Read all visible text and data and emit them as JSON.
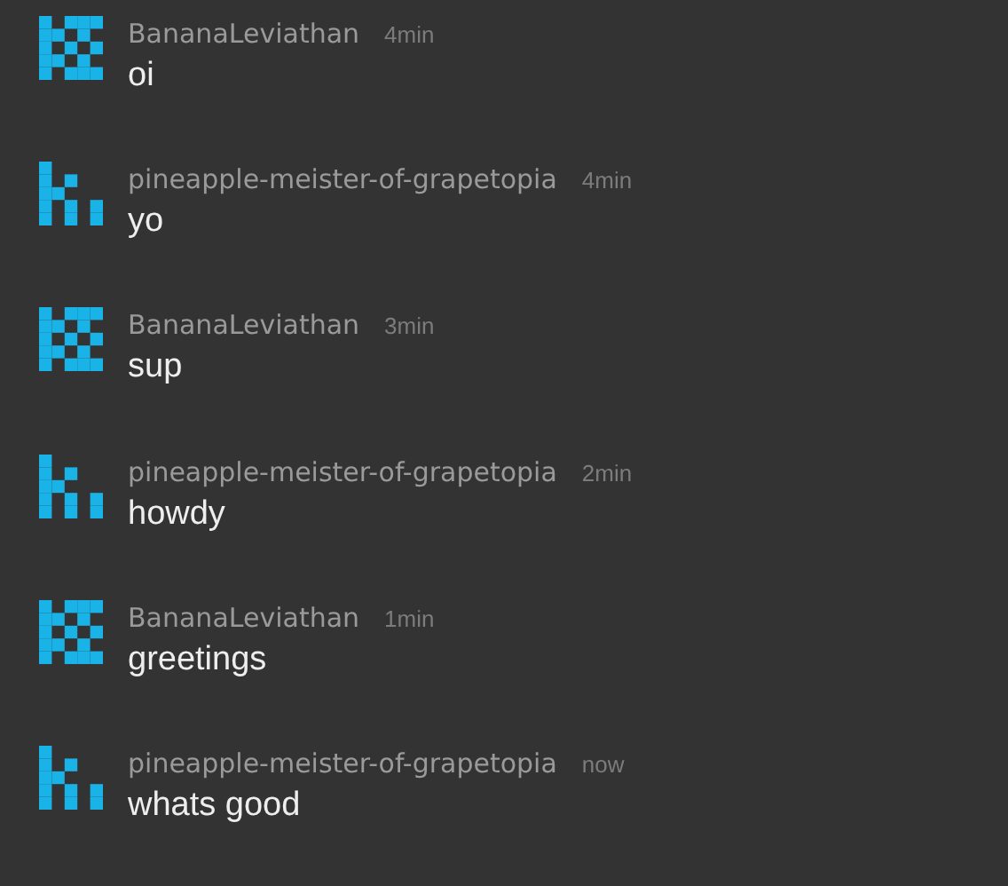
{
  "messages": [
    {
      "author": "BananaLeviathan",
      "kind": "grid",
      "time": "4min",
      "text": "oi"
    },
    {
      "author": "pineapple-meister-of-grapetopia",
      "kind": "letter",
      "time": "4min",
      "text": "yo"
    },
    {
      "author": "BananaLeviathan",
      "kind": "grid",
      "time": "3min",
      "text": "sup"
    },
    {
      "author": "pineapple-meister-of-grapetopia",
      "kind": "letter",
      "time": "2min",
      "text": "howdy"
    },
    {
      "author": "BananaLeviathan",
      "kind": "grid",
      "time": "1min",
      "text": "greetings"
    },
    {
      "author": "pineapple-meister-of-grapetopia",
      "kind": "letter",
      "time": "now",
      "text": "whats good"
    }
  ]
}
